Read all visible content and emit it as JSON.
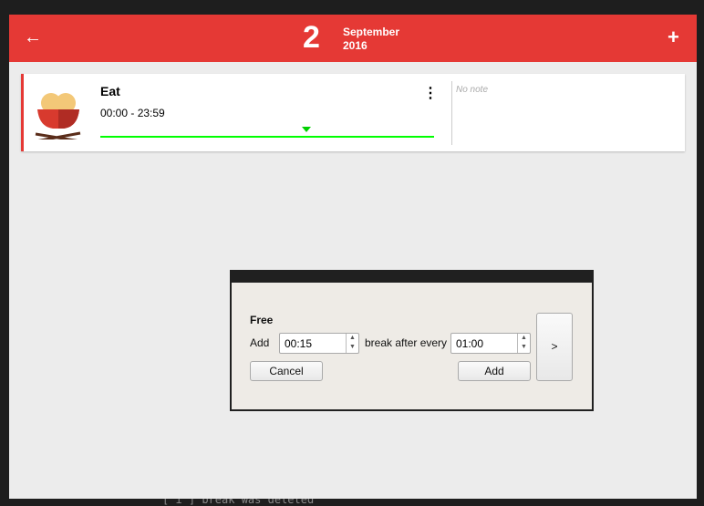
{
  "console_text": "[ i ] break was deleted",
  "header": {
    "back_icon": "arrow-left-icon",
    "day": "2",
    "month": "September",
    "year": "2016",
    "add_icon": "plus-icon"
  },
  "card": {
    "title": "Eat",
    "time": "00:00 - 23:59",
    "note": "No note",
    "accent": "#e53935",
    "progress_color": "#00ff00"
  },
  "dialog": {
    "heading": "Free",
    "add_label": "Add",
    "break_value": "00:15",
    "middle_label": "break after every",
    "every_value": "01:00",
    "cancel": "Cancel",
    "add_button": "Add",
    "next": ">"
  }
}
